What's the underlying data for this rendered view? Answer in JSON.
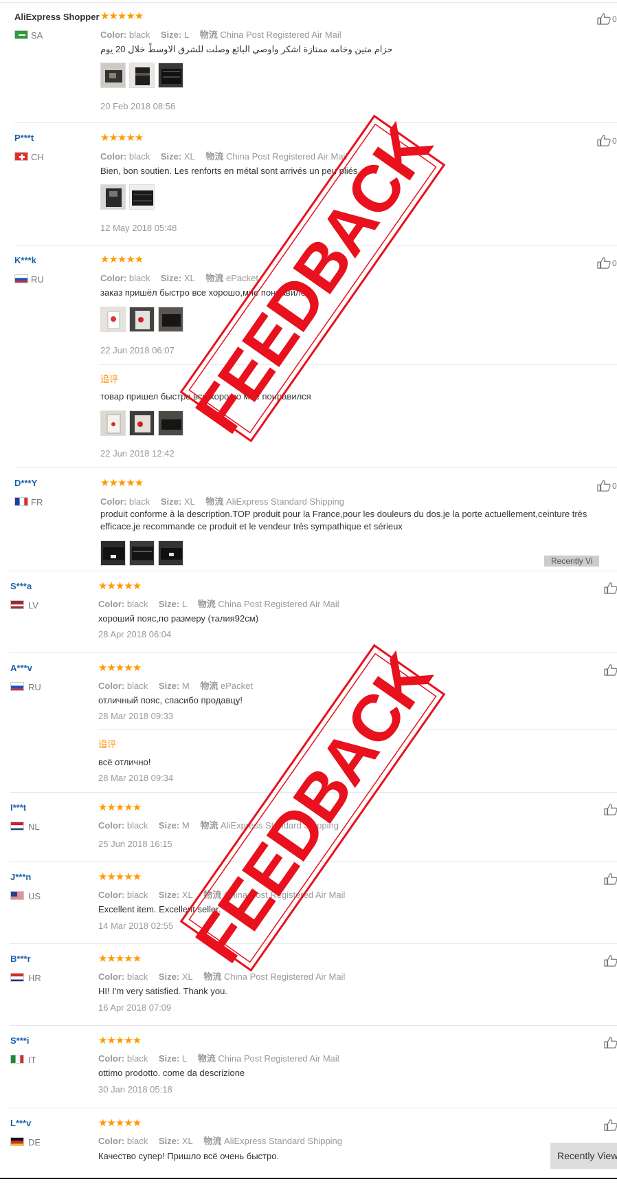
{
  "labels": {
    "color": "Color:",
    "size": "Size:",
    "shipping": "物流"
  },
  "append_label": "追评",
  "stars": "★★★★★",
  "stamp_text": "FEEDBACK",
  "recently_viewed": "Recently Viewed",
  "recently_viewed_partial": "Recently Vi",
  "thumb_count_partial": "0",
  "reviews": [
    {
      "user": "AliExpress Shopper",
      "country": "SA",
      "color": "black",
      "size": "L",
      "shipping": "China Post Registered Air Mail",
      "text": "حزام متين وخامه ممتازة اشكر واوصي البائع وصلت للشرق الاوسطً خلال 20 يوم",
      "date": "20 Feb 2018 08:56"
    },
    {
      "user": "P***t",
      "country": "CH",
      "color": "black",
      "size": "XL",
      "shipping": "China Post Registered Air Mail",
      "text": "Bien, bon soutien. Les renforts en métal sont arrivés un peu pliés.",
      "date": "12 May 2018 05:48"
    },
    {
      "user": "K***k",
      "country": "RU",
      "color": "black",
      "size": "XL",
      "shipping": "ePacket",
      "text": "заказ пришёл быстро все хорошо,мне понравилось",
      "date": "22 Jun 2018 06:07",
      "followup": {
        "text": "товар пришел быстро все хорошо мне понравился",
        "date": "22 Jun 2018 12:42"
      }
    },
    {
      "user": "D***Y",
      "country": "FR",
      "color": "black",
      "size": "XL",
      "shipping": "AliExpress Standard Shipping",
      "text_line1": "produit conforme à la description.TOP produit pour la France,pour les douleurs du dos.je la porte actuellement,ceinture très",
      "text_line2": "efficace.je recommande ce produit et le vendeur très sympathique et sérieux"
    },
    {
      "user": "S***a",
      "country": "LV",
      "color": "black",
      "size": "L",
      "shipping": "China Post Registered Air Mail",
      "text": "хороший пояс,по размеру (талия92см)",
      "date": "28 Apr 2018 06:04"
    },
    {
      "user": "A***v",
      "country": "RU",
      "color": "black",
      "size": "M",
      "shipping": "ePacket",
      "text": "отличный пояс, спасибо продавцу!",
      "date": "28 Mar 2018 09:33",
      "followup": {
        "text": "всё отлично!",
        "date": "28 Mar 2018 09:34"
      }
    },
    {
      "user": "I***t",
      "country": "NL",
      "color": "black",
      "size": "M",
      "shipping": "AliExpress Standard Shipping",
      "date": "25 Jun 2018 16:15"
    },
    {
      "user": "J***n",
      "country": "US",
      "color": "black",
      "size": "XL",
      "shipping": "China Post Registered Air Mail",
      "text": "Excellent item. Excellent seller.",
      "date": "14 Mar 2018 02:55"
    },
    {
      "user": "B***r",
      "country": "HR",
      "color": "black",
      "size": "XL",
      "shipping": "China Post Registered Air Mail",
      "text": "HI! I'm very satisfied. Thank you.",
      "date": "16 Apr 2018 07:09"
    },
    {
      "user": "S***i",
      "country": "IT",
      "color": "black",
      "size": "L",
      "shipping": "China Post Registered Air Mail",
      "text": "ottimo prodotto. come da descrizione",
      "date": "30 Jan 2018 05:18"
    },
    {
      "user": "L***v",
      "country": "DE",
      "color": "black",
      "size": "XL",
      "shipping": "AliExpress Standard Shipping",
      "text": "Качество супер! Пришло всё очень быстро."
    }
  ]
}
